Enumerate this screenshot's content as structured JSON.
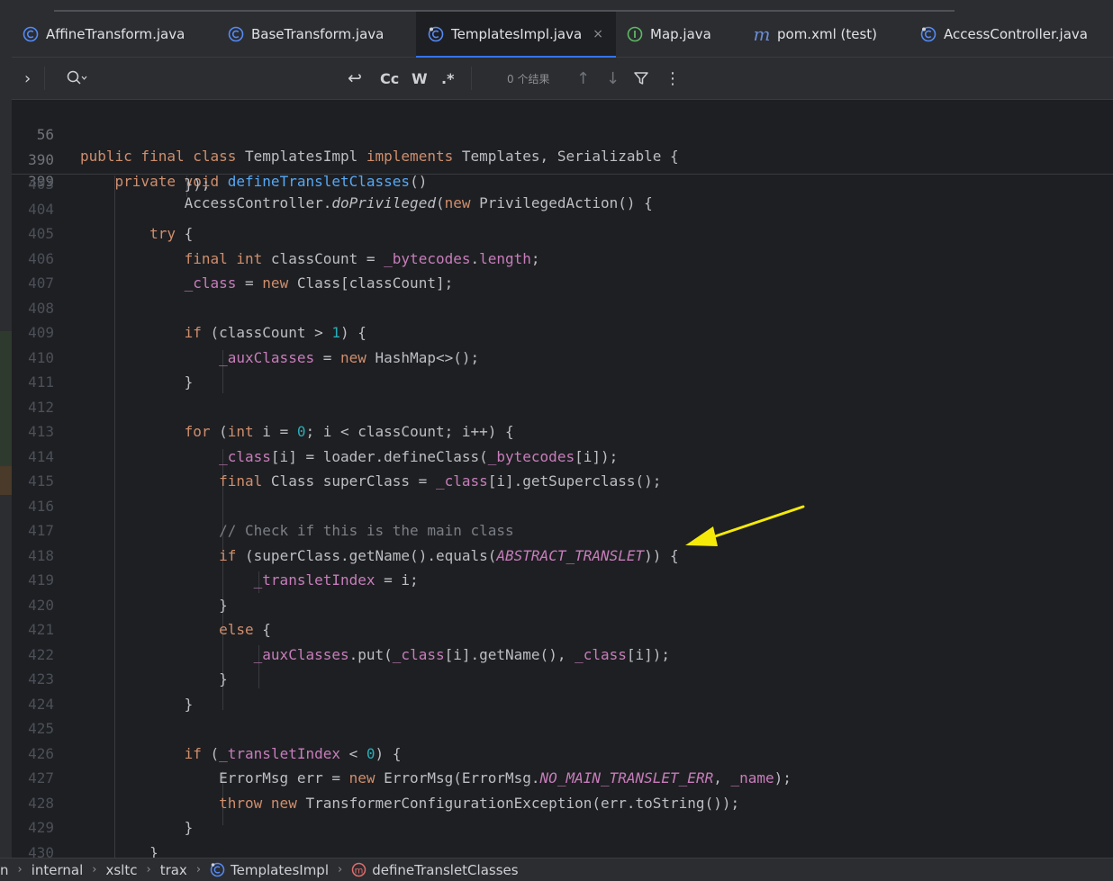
{
  "tabs": [
    {
      "label": "AffineTransform.java",
      "icon": "class-icon"
    },
    {
      "label": "BaseTransform.java",
      "icon": "class-icon"
    },
    {
      "label": "TemplatesImpl.java",
      "icon": "class-icon",
      "active": true,
      "close": "×"
    },
    {
      "label": "Map.java",
      "icon": "interface-icon"
    },
    {
      "label": "pom.xml (test)",
      "icon": "maven-icon",
      "icon_text": "m"
    },
    {
      "label": "AccessController.java",
      "icon": "class-icon"
    }
  ],
  "find": {
    "expand": "›",
    "opts": {
      "newline": "↩",
      "match_case": "Cc",
      "words": "W",
      "regex": ".*"
    },
    "results": "0 个结果",
    "prev": "↑",
    "next": "↓",
    "more": "⋮"
  },
  "sticky": [
    {
      "ln": "56",
      "code": "public final class TemplatesImpl implements Templates, Serializable {"
    },
    {
      "ln": "390",
      "code": "    private void defineTransletClasses()"
    },
    {
      "ln": "399",
      "code": "            AccessController.doPrivileged(new PrivilegedAction() {"
    }
  ],
  "lines": [
    {
      "ln": "403",
      "code": "            });"
    },
    {
      "ln": "404",
      "code": ""
    },
    {
      "ln": "405",
      "code": "        try {"
    },
    {
      "ln": "406",
      "code": "            final int classCount = _bytecodes.length;"
    },
    {
      "ln": "407",
      "code": "            _class = new Class[classCount];"
    },
    {
      "ln": "408",
      "code": ""
    },
    {
      "ln": "409",
      "code": "            if (classCount > 1) {"
    },
    {
      "ln": "410",
      "code": "                _auxClasses = new HashMap<>();"
    },
    {
      "ln": "411",
      "code": "            }"
    },
    {
      "ln": "412",
      "code": ""
    },
    {
      "ln": "413",
      "code": "            for (int i = 0; i < classCount; i++) {"
    },
    {
      "ln": "414",
      "code": "                _class[i] = loader.defineClass(_bytecodes[i]);"
    },
    {
      "ln": "415",
      "code": "                final Class superClass = _class[i].getSuperclass();"
    },
    {
      "ln": "416",
      "code": ""
    },
    {
      "ln": "417",
      "code": "                // Check if this is the main class"
    },
    {
      "ln": "418",
      "code": "                if (superClass.getName().equals(ABSTRACT_TRANSLET)) {"
    },
    {
      "ln": "419",
      "code": "                    _transletIndex = i;"
    },
    {
      "ln": "420",
      "code": "                }"
    },
    {
      "ln": "421",
      "code": "                else {"
    },
    {
      "ln": "422",
      "code": "                    _auxClasses.put(_class[i].getName(), _class[i]);"
    },
    {
      "ln": "423",
      "code": "                }"
    },
    {
      "ln": "424",
      "code": "            }"
    },
    {
      "ln": "425",
      "code": ""
    },
    {
      "ln": "426",
      "code": "            if (_transletIndex < 0) {"
    },
    {
      "ln": "427",
      "code": "                ErrorMsg err = new ErrorMsg(ErrorMsg.NO_MAIN_TRANSLET_ERR, _name);"
    },
    {
      "ln": "428",
      "code": "                throw new TransformerConfigurationException(err.toString());"
    },
    {
      "ln": "429",
      "code": "            }"
    },
    {
      "ln": "430",
      "code": "        }"
    }
  ],
  "breadcrumb": [
    {
      "label": "n"
    },
    {
      "label": "internal"
    },
    {
      "label": "xsltc"
    },
    {
      "label": "trax"
    },
    {
      "label": "TemplatesImpl",
      "icon": "class-icon"
    },
    {
      "label": "defineTransletClasses",
      "icon": "method-icon",
      "icon_text": "m"
    }
  ],
  "breadcrumb_sep": "›",
  "colors": {
    "background": "#1e1f22",
    "keyword": "#cf8e6d",
    "method": "#56a8f5",
    "field": "#c77dbb",
    "number": "#2aacb8",
    "comment": "#7a7e85",
    "annotation_arrow": "#f5e90a",
    "accent": "#3574f0"
  }
}
